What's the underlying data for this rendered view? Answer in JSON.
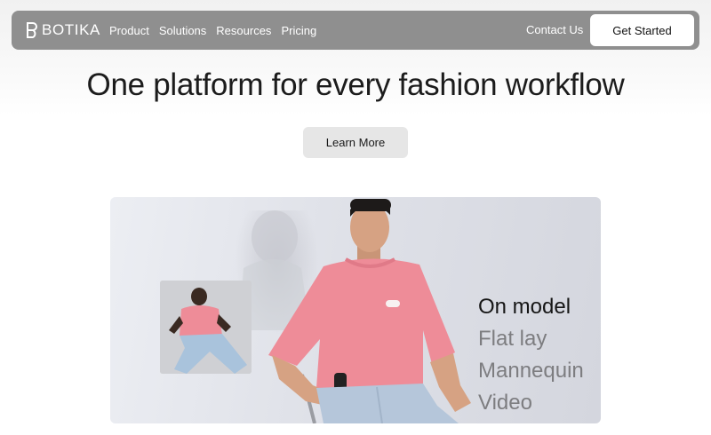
{
  "nav": {
    "brand": "BOTIKA",
    "items": [
      {
        "label": "Product"
      },
      {
        "label": "Solutions"
      },
      {
        "label": "Resources"
      },
      {
        "label": "Pricing"
      }
    ],
    "contact_label": "Contact Us",
    "cta_label": "Get Started"
  },
  "hero": {
    "title": "One platform for every fashion workflow",
    "button_label": "Learn More"
  },
  "showcase": {
    "options": [
      {
        "label": "On model",
        "active": true
      },
      {
        "label": "Flat lay",
        "active": false
      },
      {
        "label": "Mannequin",
        "active": false
      },
      {
        "label": "Video",
        "active": false
      }
    ]
  },
  "colors": {
    "nav_bg": "#8f8f8f",
    "shirt_pink": "#ee8c98",
    "jeans_blue": "#b5c6da",
    "button_grey": "#e6e6e6"
  }
}
